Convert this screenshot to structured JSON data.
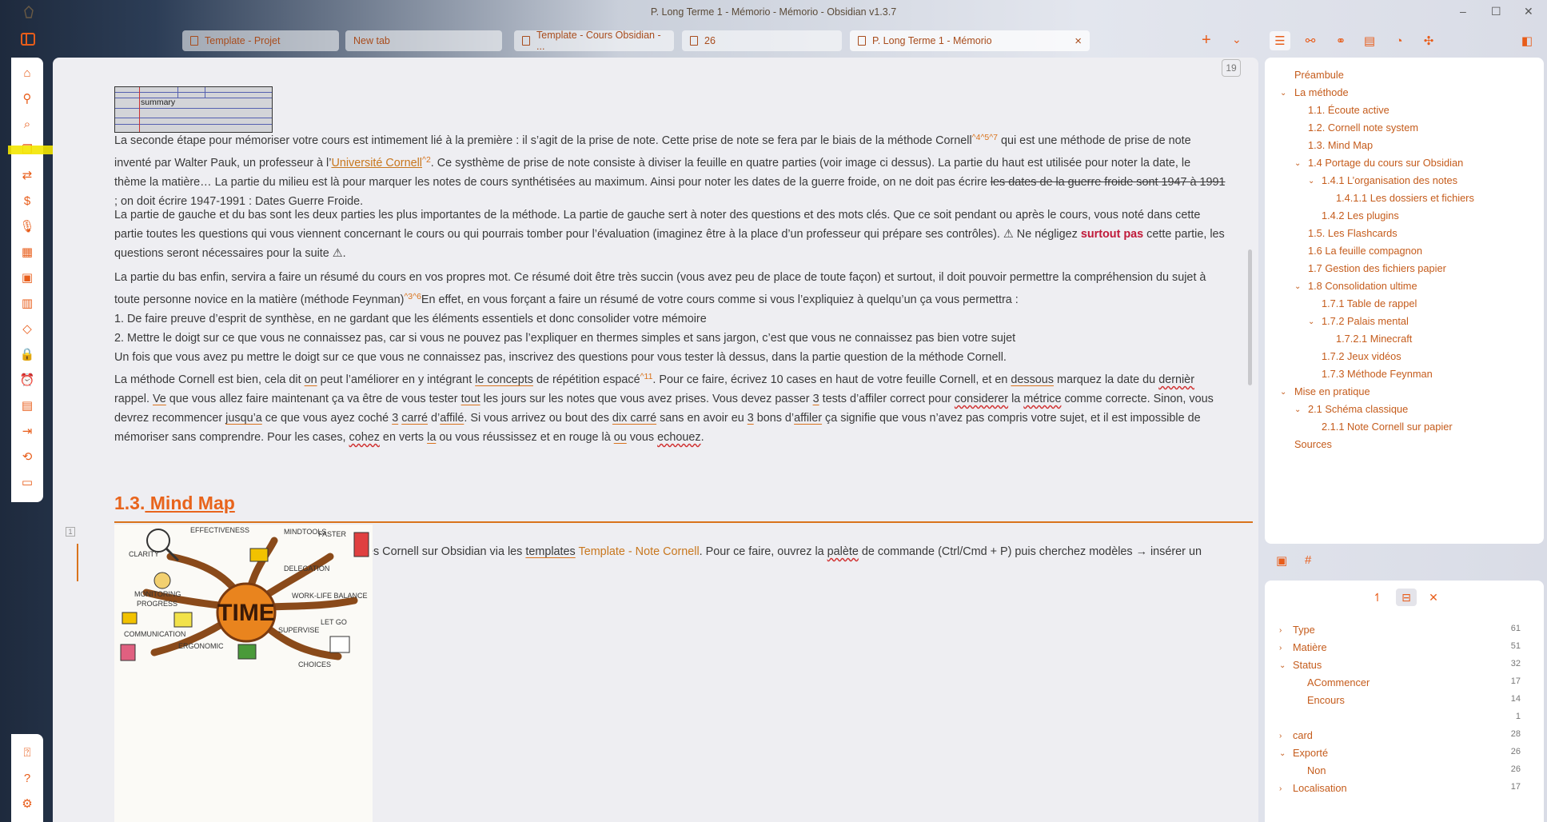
{
  "window": {
    "title": "P. Long Terme 1 - Mémorio - Mémorio - Obsidian v1.3.7",
    "minimize": "–",
    "maximize": "☐",
    "close": "✕"
  },
  "tabs": [
    {
      "label": "Template - Projet"
    },
    {
      "label": "New tab"
    },
    {
      "label": "Template - Cours Obsidian - ..."
    },
    {
      "label": "26"
    },
    {
      "label": "P. Long Terme 1 - Mémorio",
      "active": true
    }
  ],
  "tabbar": {
    "new_tab": "+",
    "tab_list": "⌄"
  },
  "editor": {
    "page_number": "19",
    "fold_badge": "1",
    "cornell_label": "summary",
    "p1": {
      "a": "La seconde étape pour mémoriser votre cours est intimement lié à la première : il s’agit de la prise de note. Cette prise de note se fera par le biais de la méthode Cornell",
      "fn1": "^4^5^7",
      "b": " qui est une méthode de prise de note inventé par Walter Pauk, un professeur à l’",
      "link": "Université Cornell",
      "fn2": "^2",
      "c": ". Ce systhème de prise de note consiste à diviser la feuille en quatre parties (voir image ci dessus). La partie du haut est utilisée pour noter la date, le thème la matière… La partie du milieu est là pour marquer les notes de cours synthétisées au maximum. Ainsi pour noter les dates de la guerre froide, on ne doit pas écrire ",
      "strike": "les dates de la guerre froide sont 1947 à 1991",
      "d": " ; on doit écrire 1947-1991 : Dates Guerre Froide."
    },
    "p2": {
      "a": "La partie de gauche et du bas sont les deux parties les plus importantes de la méthode. La partie de gauche sert à noter des questions et des mots clés. Que ce soit pendant ou après le cours, vous noté dans cette partie toutes les questions qui vous viennent concernant le cours ou qui pourrais tomber pour l’évaluation (imaginez être à la place d’un professeur qui prépare ses contrôles). ⚠ Ne négligez ",
      "bold": "surtout pas",
      "b": " cette partie, les questions seront nécessaires pour la suite ⚠."
    },
    "p3": {
      "a": "La partie du bas enfin, servira a faire un résumé du cours en vos propres mot. Ce résumé doit être très succin (vous avez peu de place de toute façon) et surtout, il doit pouvoir permettre la compréhension du sujet à toute personne novice en la matière (méthode Feynman)",
      "fn": "^3^6",
      "b": "En effet, en vous forçant a faire un résumé de votre cours comme si vous l’expliquiez à quelqu’un ça vous permettra :"
    },
    "list": [
      "De faire preuve d’esprit de synthèse, en ne gardant que les éléments essentiels et donc consolider votre mémoire",
      "Mettre le doigt sur ce que vous ne connaissez pas, car si vous ne pouvez pas l’expliquer en thermes simples et sans jargon, c’est que vous ne connaissez pas bien votre sujet"
    ],
    "p4": "Un fois que vous avez pu mettre le doigt sur ce que vous ne connaissez pas, inscrivez des questions pour vous tester là dessus, dans la partie question de la méthode Cornell.",
    "p5": {
      "a": "La méthode Cornell est bien, cela dit ",
      "on": "on",
      "b": " peut l’améliorer en y intégrant ",
      "lec": "le concepts",
      "c": " de répétition espacé",
      "fn": "^11",
      "d": ". Pour ce faire, écrivez 10 cases en haut de votre feuille Cornell, et en ",
      "dessous": "dessous",
      "e": " marquez la date du ",
      "dernier": "dernièr",
      "f": " rappel. ",
      "ve": "Ve",
      "g": " que vous allez faire maintenant ça va être de vous tester ",
      "tout": "tout",
      "h": " les jours sur les notes que vous avez prises. Vous devez passer ",
      "n3a": "3",
      "i": " tests d’affiler correct pour ",
      "considerer": "considerer",
      "j": " la ",
      "metrice": "métrice",
      "k": " comme correcte. Sinon, vous devrez recommencer ",
      "jusqua": "jusqu’a",
      "l": " ce que vous ayez coché ",
      "n3b": "3",
      "m": " ",
      "carre": "carré",
      "n": " d’",
      "affile": "affilé",
      "o": ". Si vous arrivez ou bout des ",
      "dixcarre": "dix carré",
      "p": " sans en avoir eu ",
      "n3c": "3",
      "q": " bons d’",
      "affiler": "affiler",
      "r": " ça signifie que vous n’avez pas compris votre sujet, et il est impossible de mémoriser sans comprendre. Pour les cases, ",
      "cohez": "cohez",
      "s": " en verts ",
      "la": "la",
      "t": " ou vous réussissez et en rouge là ",
      "ou": "ou",
      "u": " vous ",
      "echouez": "echouez",
      "v": "."
    },
    "p6": {
      "a": "Vous pouvez si vous le souhaitez prendre vos notes Cornell sur Obsidian via les ",
      "templates": "templates",
      "b": " ",
      "link": "Template - Note Cornell",
      "c": ". Pour ce faire, ouvrez la ",
      "palete": "palète",
      "d": " de commande (Ctrl/Cmd + P) puis cherchez modèles → insérer un model. ou|"
    },
    "heading": {
      "num": "1.3.",
      "title": " Mind Map"
    }
  },
  "outline": [
    {
      "label": "Préambule"
    },
    {
      "label": "La méthode"
    },
    {
      "label": "1.1. Écoute active"
    },
    {
      "label": "1.2. Cornell note system"
    },
    {
      "label": "1.3. Mind Map"
    },
    {
      "label": "1.4 Portage du cours sur Obsidian"
    },
    {
      "label": "1.4.1 L’organisation des notes"
    },
    {
      "label": "1.4.1.1 Les dossiers et fichiers"
    },
    {
      "label": "1.4.2 Les plugins"
    },
    {
      "label": "1.5. Les Flashcards"
    },
    {
      "label": "1.6 La feuille compagnon"
    },
    {
      "label": "1.7 Gestion des fichiers papier"
    },
    {
      "label": "1.8 Consolidation ultime"
    },
    {
      "label": "1.7.1 Table de rappel"
    },
    {
      "label": "1.7.2 Palais mental"
    },
    {
      "label": "1.7.2.1 Minecraft"
    },
    {
      "label": "1.7.2 Jeux vidéos"
    },
    {
      "label": "1.7.3 Méthode Feynman"
    },
    {
      "label": "Mise en pratique"
    },
    {
      "label": "2.1 Schéma classique"
    },
    {
      "label": "2.1.1 Note Cornell sur papier"
    },
    {
      "label": "Sources"
    }
  ],
  "properties": [
    {
      "label": "Type",
      "count": "61"
    },
    {
      "label": "Matière",
      "count": "51"
    },
    {
      "label": "Status",
      "count": "32"
    },
    {
      "label": "ACommencer",
      "count": "17"
    },
    {
      "label": "Encours",
      "count": "14"
    },
    {
      "label": "",
      "count": "1"
    },
    {
      "label": "card",
      "count": "28"
    },
    {
      "label": "Exporté",
      "count": "26"
    },
    {
      "label": "Non",
      "count": "26"
    },
    {
      "label": "Localisation",
      "count": "17"
    }
  ],
  "mindmap": {
    "center": "TIME",
    "words": [
      "CLARITY",
      "EFFECTIVENESS",
      "MONITORING",
      "PROGRESS",
      "WORK-LIFE BALANCE",
      "LET GO",
      "DELEGATION",
      "COMMUNICATION",
      "ERGONOMIC",
      "SUPERVISE",
      "CHOICES",
      "FASTER",
      "MINDTOOLS"
    ]
  }
}
